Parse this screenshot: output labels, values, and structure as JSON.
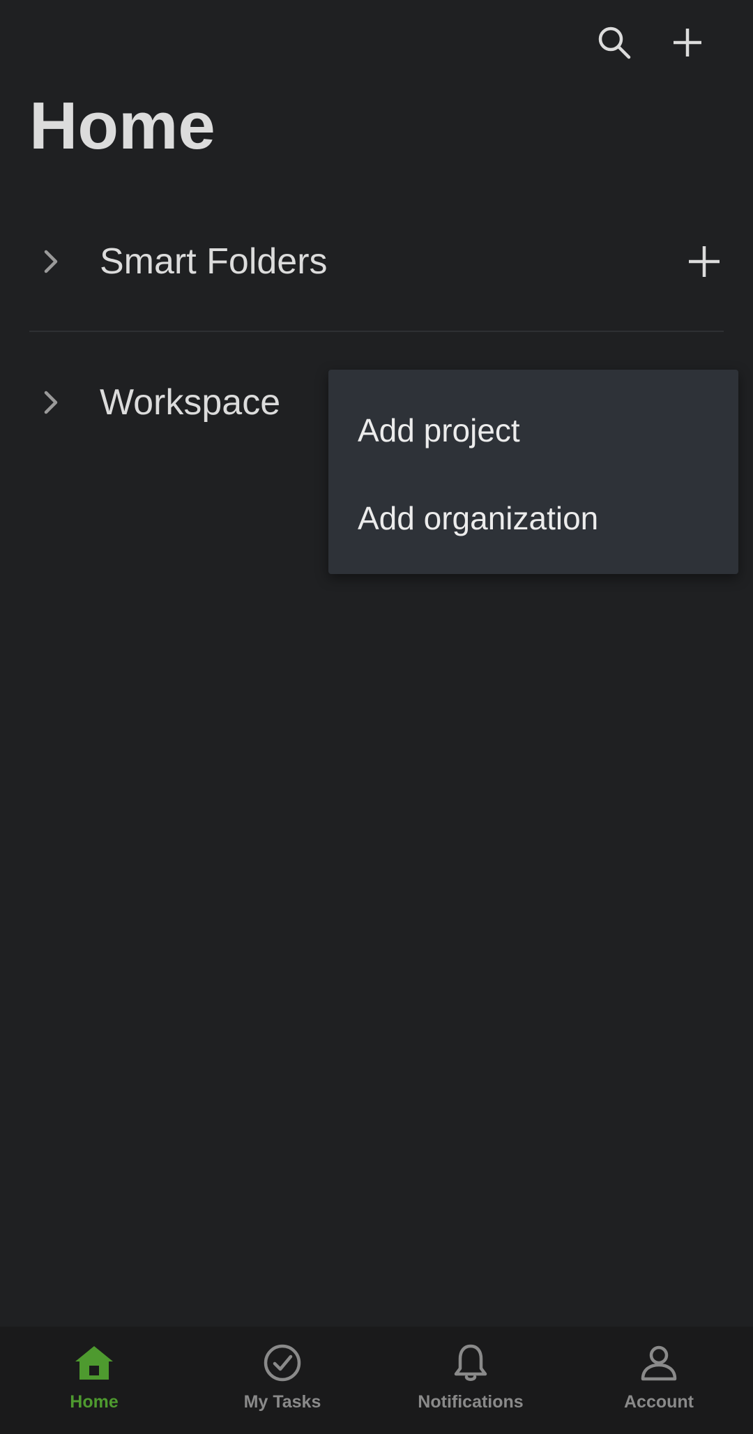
{
  "header": {
    "title": "Home",
    "search_icon": "search-icon",
    "add_icon": "plus-icon"
  },
  "sections": [
    {
      "label": "Smart Folders",
      "icon": "chevron-right-icon",
      "action_icon": "plus-icon"
    },
    {
      "label": "Workspace",
      "icon": "chevron-right-icon"
    }
  ],
  "menu": {
    "items": [
      {
        "label": "Add project"
      },
      {
        "label": "Add organization"
      }
    ]
  },
  "bottom_nav": {
    "items": [
      {
        "label": "Home",
        "icon": "home-icon",
        "active": true
      },
      {
        "label": "My Tasks",
        "icon": "check-circle-icon",
        "active": false
      },
      {
        "label": "Notifications",
        "icon": "bell-icon",
        "active": false
      },
      {
        "label": "Account",
        "icon": "person-icon",
        "active": false
      }
    ]
  },
  "colors": {
    "background": "#1f2022",
    "menu_background": "#2e3238",
    "accent": "#4e9a2f",
    "inactive": "#8a8a8a",
    "text": "#dcdcdc"
  }
}
